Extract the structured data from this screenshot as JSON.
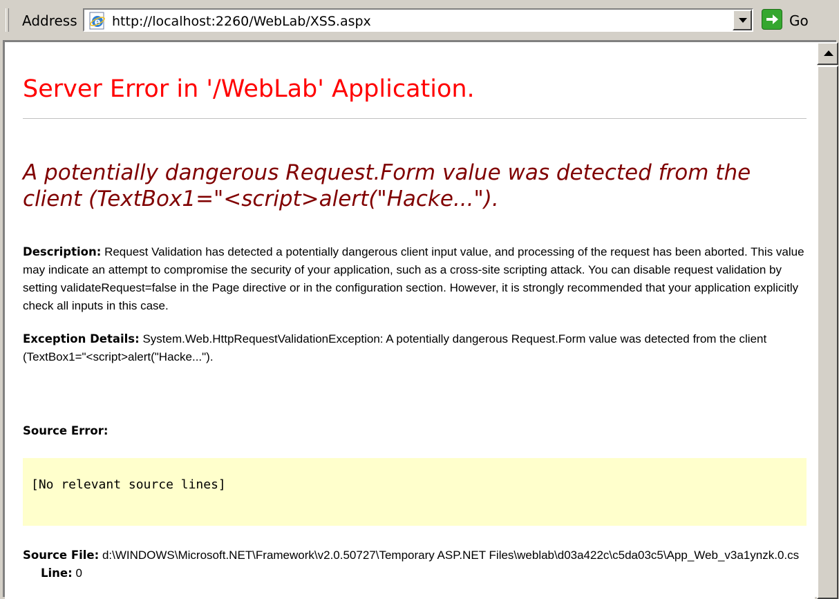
{
  "address_bar": {
    "label": "Address",
    "url": "http://localhost:2260/WebLab/XSS.aspx",
    "go_label": "Go"
  },
  "error_page": {
    "title": "Server Error in '/WebLab' Application.",
    "headline": "A potentially dangerous Request.Form value was detected from the client (TextBox1=\"<script>alert(\"Hacke...\").",
    "description": {
      "label": "Description:",
      "text": "Request Validation has detected a potentially dangerous client input value, and processing of the request has been aborted. This value may indicate an attempt to compromise the security of your application, such as a cross-site scripting attack. You can disable request validation by setting validateRequest=false in the Page directive or in the configuration section. However, it is strongly recommended that your application explicitly check all inputs in this case."
    },
    "exception": {
      "label": "Exception Details:",
      "text": "System.Web.HttpRequestValidationException: A potentially dangerous Request.Form value was detected from the client (TextBox1=\"<script>alert(\"Hacke...\")."
    },
    "source_error": {
      "label": "Source Error:",
      "code": "[No relevant source lines]"
    },
    "source_file": {
      "label": "Source File:",
      "path": "d:\\WINDOWS\\Microsoft.NET\\Framework\\v2.0.50727\\Temporary ASP.NET Files\\weblab\\d03a422c\\c5da03c5\\App_Web_v3a1ynzk.0.cs",
      "line_label": "Line:",
      "line_value": "0"
    }
  },
  "colors": {
    "title": "#ff0000",
    "headline": "#800000",
    "code_background": "#ffffcc",
    "chrome": "#d4d0c8"
  },
  "icons": {
    "page": "ie-page-icon",
    "dropdown": "chevron-down-icon",
    "go": "go-arrow-icon",
    "scroll_up": "scroll-up-arrow-icon"
  }
}
